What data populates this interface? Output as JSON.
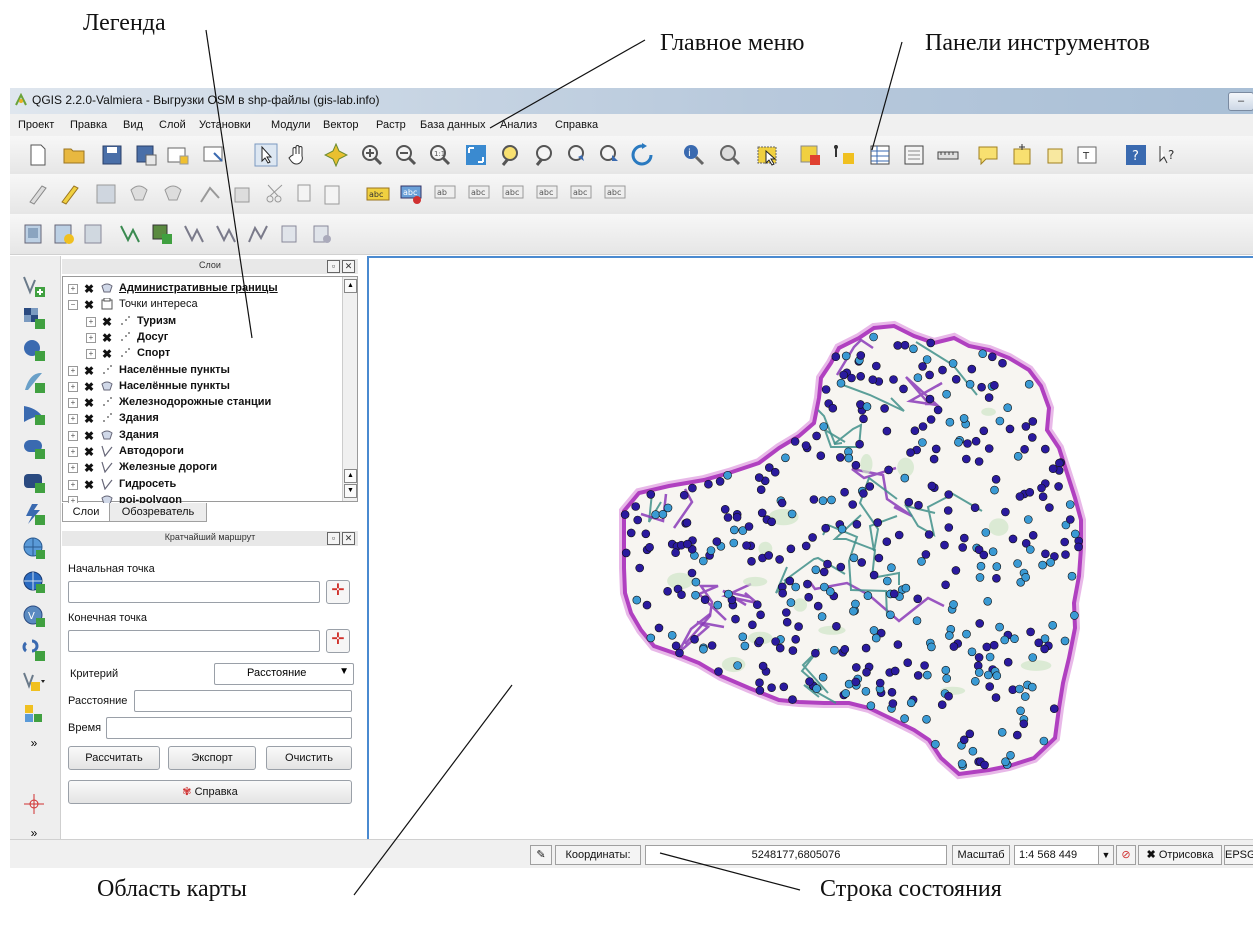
{
  "annotations": {
    "legend": "Легенда",
    "main_menu": "Главное меню",
    "toolbars": "Панели инструментов",
    "map_area": "Область карты",
    "status_bar": "Строка состояния"
  },
  "window": {
    "title": "QGIS 2.2.0-Valmiera - Выгрузки OSM в shp-файлы (gis-lab.info)"
  },
  "menu": [
    "Проект",
    "Правка",
    "Вид",
    "Слой",
    "Установки",
    "Модули",
    "Вектор",
    "Растр",
    "База данных",
    "Анализ",
    "Справка"
  ],
  "layers_panel": {
    "title": "Слои",
    "items": [
      {
        "label": "Административные границы",
        "bold": true,
        "underline": true,
        "indent": 0,
        "icon": "polygon-layer-icon"
      },
      {
        "label": "Точки интереса",
        "bold": false,
        "indent": 0,
        "icon": "group-icon"
      },
      {
        "label": "Туризм",
        "bold": true,
        "indent": 1,
        "icon": "point-layer-icon"
      },
      {
        "label": "Досуг",
        "bold": true,
        "indent": 1,
        "icon": "point-layer-icon"
      },
      {
        "label": "Спорт",
        "bold": true,
        "indent": 1,
        "icon": "point-layer-icon"
      },
      {
        "label": "Населённые пункты",
        "bold": true,
        "indent": 0,
        "icon": "point-layer-icon"
      },
      {
        "label": "Населённые пункты",
        "bold": true,
        "indent": 0,
        "icon": "polygon-layer-icon"
      },
      {
        "label": "Железнодорожные станции",
        "bold": true,
        "indent": 0,
        "icon": "point-layer-icon"
      },
      {
        "label": "Здания",
        "bold": true,
        "indent": 0,
        "icon": "point-layer-icon"
      },
      {
        "label": "Здания",
        "bold": true,
        "indent": 0,
        "icon": "polygon-layer-icon"
      },
      {
        "label": "Автодороги",
        "bold": true,
        "indent": 0,
        "icon": "line-layer-icon"
      },
      {
        "label": "Железные дороги",
        "bold": true,
        "indent": 0,
        "icon": "line-layer-icon"
      },
      {
        "label": "Гидросеть",
        "bold": true,
        "indent": 0,
        "icon": "line-layer-icon"
      },
      {
        "label": "poi-polygon",
        "bold": true,
        "indent": 0,
        "icon": "polygon-layer-icon"
      }
    ],
    "tabs": [
      "Слои",
      "Обозреватель"
    ]
  },
  "route_panel": {
    "title": "Кратчайший маршрут",
    "start_label": "Начальная точка",
    "end_label": "Конечная точка",
    "criterion_label": "Критерий",
    "criterion_value": "Расстояние",
    "distance_label": "Расстояние",
    "time_label": "Время",
    "calc_button": "Рассчитать",
    "export_button": "Экспорт",
    "clear_button": "Очистить",
    "help_button": "Справка"
  },
  "statusbar": {
    "coords_label": "Координаты:",
    "coords_value": "5248177,6805076",
    "scale_label": "Масштаб",
    "scale_value": "1:4 568 449",
    "render_label": "Отрисовка",
    "crs": "EPSG"
  },
  "colors": {
    "accent": "#4a8ad0",
    "boundary": "#c04dc8",
    "poi_dark": "#2a1a9e",
    "poi_light": "#3a9ad4",
    "roads": "#3f8f8a"
  }
}
